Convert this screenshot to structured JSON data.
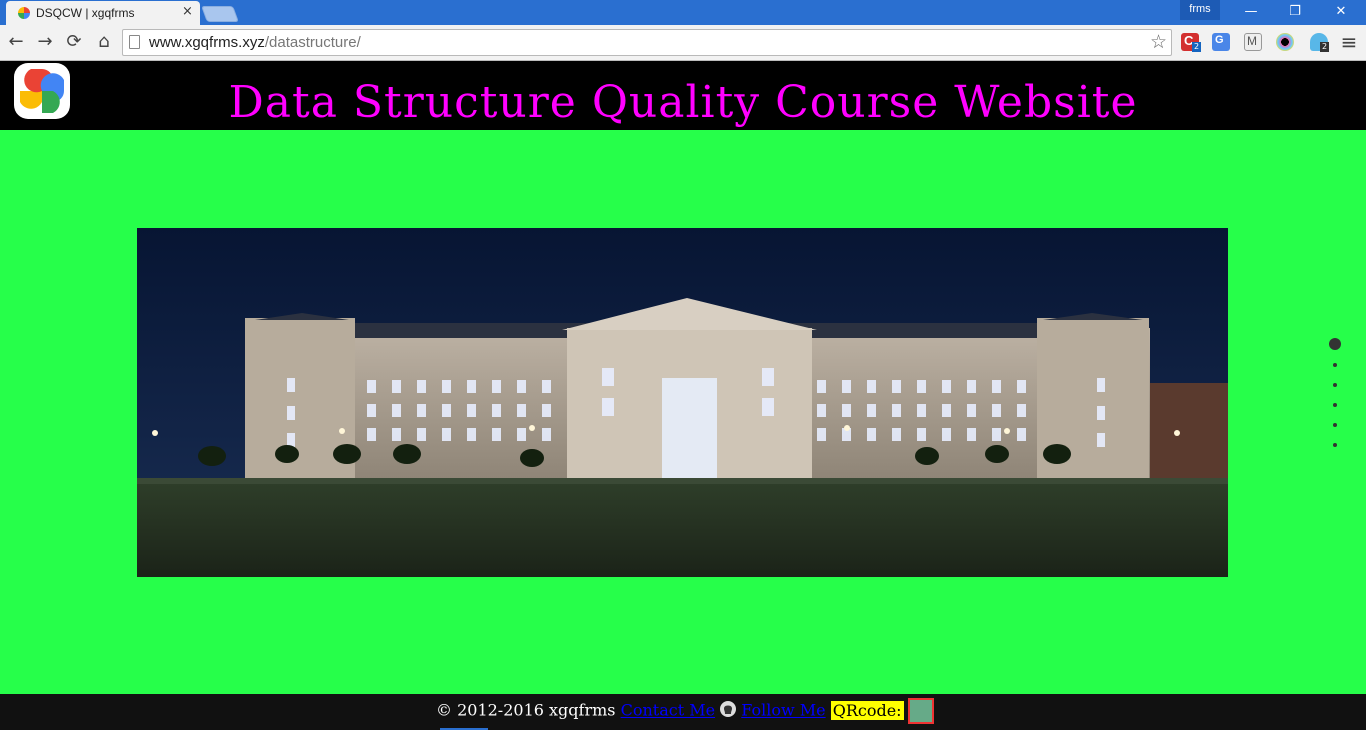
{
  "browser": {
    "tab_title": "DSQCW | xgqfrms",
    "tab_close": "×",
    "profile_name": "frms",
    "window_controls": {
      "minimize": "—",
      "restore": "❐",
      "close": "✕"
    },
    "nav": {
      "back": "←",
      "forward": "→",
      "reload": "⟳",
      "home": "⌂"
    },
    "address": {
      "host": "www.xgqfrms.xyz",
      "path": "/datastructure/"
    },
    "bookmark_star": "☆",
    "extensions": [
      "c-extension-icon",
      "google-translate-icon",
      "gmail-checker-icon",
      "color-picker-icon",
      "ghostery-icon"
    ],
    "menu": "≡",
    "ext_badge_1": "2",
    "ext_badge_5": "2"
  },
  "page": {
    "title": "Data Structure Quality Course Website",
    "logo_icon": "google-photos-pinwheel-icon",
    "hero_image": "university-library-building-at-night",
    "slider": {
      "count": 6,
      "active_index": 0
    },
    "footer": {
      "copyright": "© 2012-2016 xgqfrms",
      "contact_link": "Contact Me",
      "github_icon": "github-octocat-icon",
      "follow_link": "Follow Me",
      "qr_label": "QRcode:"
    }
  },
  "colors": {
    "page_background": "#26ff4a",
    "header_background": "#000000",
    "title_color": "#ff00ff",
    "footer_background": "#111111",
    "link_color": "#0000ff",
    "qr_label_background": "#ffff00"
  }
}
